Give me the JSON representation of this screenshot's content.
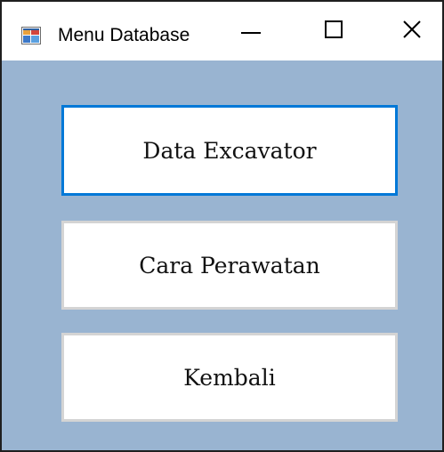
{
  "window": {
    "title": "Menu Database",
    "background_color": "#99b4d1",
    "accent_color": "#0078d7",
    "icons": {
      "app": "form-app-icon",
      "minimize": "minimize-icon",
      "maximize": "maximize-icon",
      "close": "close-icon"
    }
  },
  "menu": {
    "buttons": [
      {
        "label": "Data Excavator",
        "focused": true
      },
      {
        "label": "Cara Perawatan",
        "focused": false
      },
      {
        "label": "Kembali",
        "focused": false
      }
    ]
  }
}
